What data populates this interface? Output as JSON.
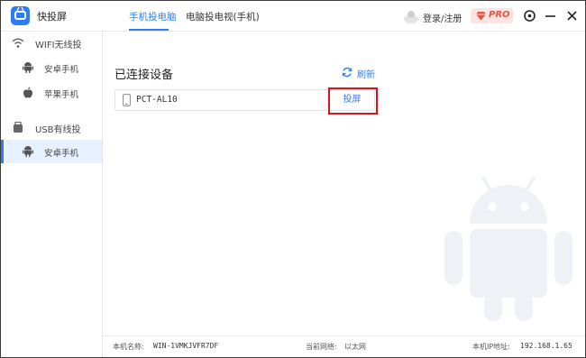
{
  "app": {
    "title": "快投屏"
  },
  "tabs": [
    {
      "label": "手机投电脑",
      "active": true
    },
    {
      "label": "电脑投电视(手机)",
      "active": false
    }
  ],
  "user": {
    "login_label": "登录/注册"
  },
  "pro_badge": "PRO",
  "sidebar": {
    "sections": [
      {
        "label": "WIFI无线投",
        "icon": "wifi-icon",
        "items": [
          {
            "label": "安卓手机",
            "icon": "android-icon",
            "active": false
          },
          {
            "label": "苹果手机",
            "icon": "apple-icon",
            "active": false
          }
        ]
      },
      {
        "label": "USB有线投",
        "icon": "usb-icon",
        "items": [
          {
            "label": "安卓手机",
            "icon": "android-icon",
            "active": true
          }
        ]
      }
    ]
  },
  "main": {
    "title": "已连接设备",
    "refresh_label": "刷新",
    "device": {
      "name": "PCT-AL10",
      "action_label": "投屏"
    }
  },
  "footer": {
    "pc_name_label": "本机名称:",
    "pc_name_value": "WIN-1VMKJVFR7DF",
    "network_label": "当前网络:",
    "network_value": "以太网",
    "ip_label": "本机IP地址:",
    "ip_value": "192.168.1.65"
  },
  "colors": {
    "accent": "#2f7cf6",
    "highlight_border": "#d9141f",
    "pro_text": "#e8553e",
    "pro_bg": "#fbe4e1"
  }
}
